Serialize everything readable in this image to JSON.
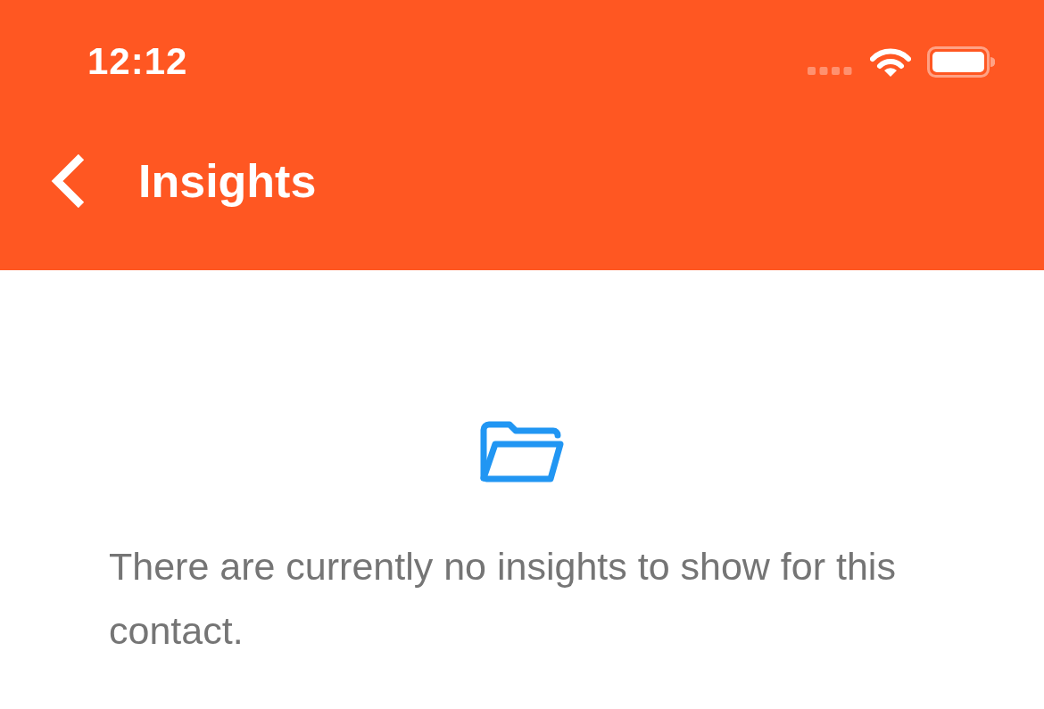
{
  "status_bar": {
    "time": "12:12"
  },
  "header": {
    "title": "Insights"
  },
  "empty_state": {
    "message": "There are currently no insights to show for this contact."
  }
}
